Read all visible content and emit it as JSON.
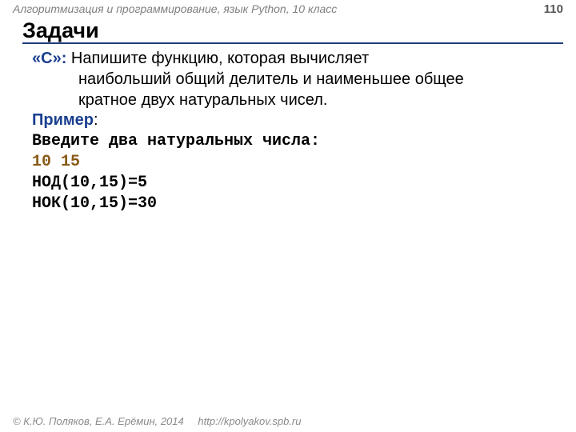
{
  "header": {
    "course": "Алгоритмизация и программирование, язык Python, 10 класс",
    "page": "110"
  },
  "title": "Задачи",
  "task": {
    "label": "«C»: ",
    "text_line1": "Напишите функцию, которая вычисляет",
    "text_line2": "наибольший общий делитель и наименьшее общее",
    "text_line3": "кратное двух натуральных чисел."
  },
  "example": {
    "label": "Пример",
    "colon": ":",
    "prompt": "Введите два натуральных числа:",
    "input": "10 15",
    "out1": "НОД(10,15)=5",
    "out2": "НОК(10,15)=30"
  },
  "footer": {
    "copyright": "© К.Ю. Поляков, Е.А. Ерёмин, 2014",
    "site": "http://kpolyakov.spb.ru"
  }
}
